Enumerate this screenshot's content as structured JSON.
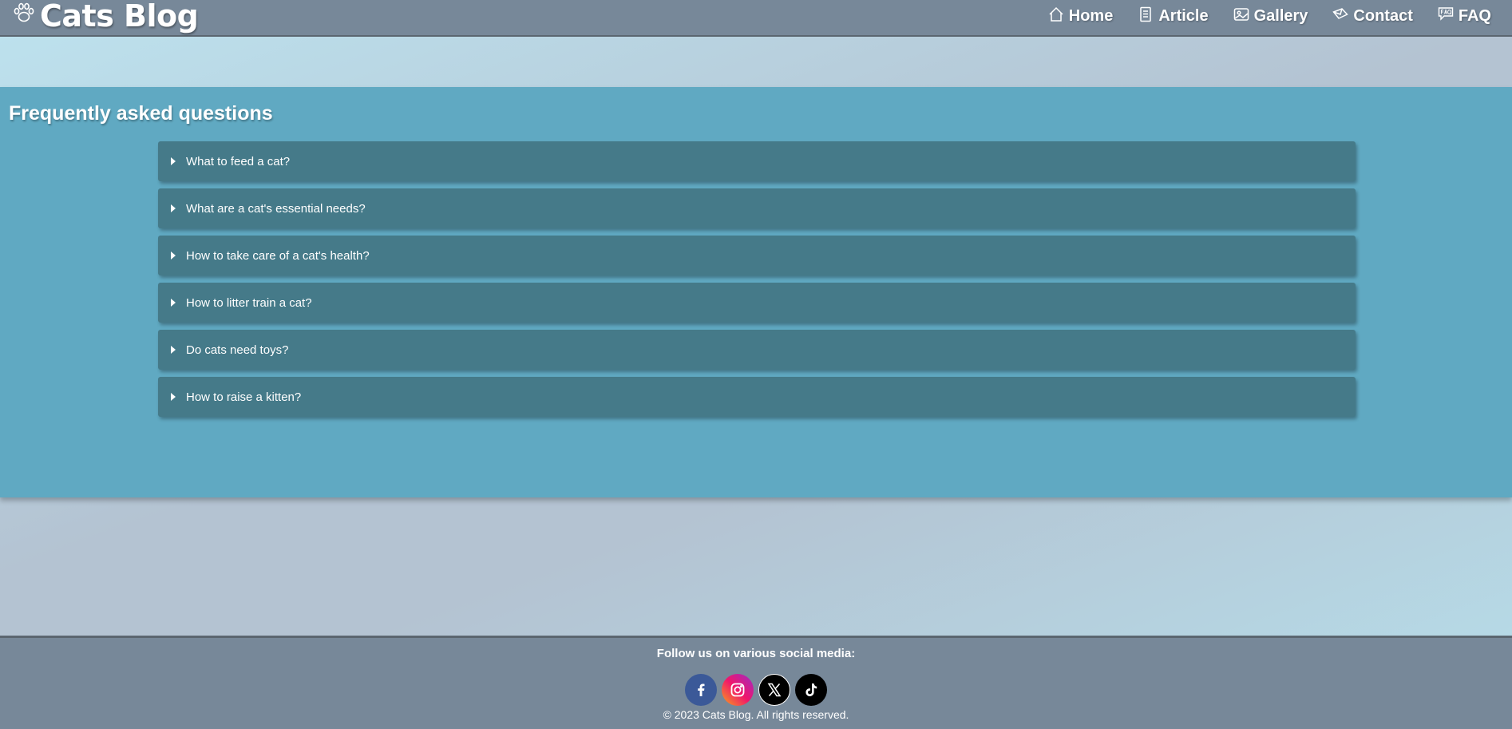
{
  "header": {
    "brand": {
      "title": "Cats Blog",
      "icon": "paw-icon"
    },
    "nav": [
      {
        "label": "Home",
        "icon": "home-icon"
      },
      {
        "label": "Article",
        "icon": "article-icon"
      },
      {
        "label": "Gallery",
        "icon": "gallery-icon"
      },
      {
        "label": "Contact",
        "icon": "contact-icon"
      },
      {
        "label": "FAQ",
        "icon": "faq-icon"
      }
    ]
  },
  "faq": {
    "title": "Frequently asked questions",
    "items": [
      "What to feed a cat?",
      "What are a cat's essential needs?",
      "How to take care of a cat's health?",
      "How to litter train a cat?",
      "Do cats need toys?",
      "How to raise a kitten?"
    ]
  },
  "footer": {
    "follow_text": "Follow us on various social media:",
    "socials": [
      {
        "icon": "facebook-icon",
        "color": "#3b5998"
      },
      {
        "icon": "instagram-icon",
        "color": "#e1306c"
      },
      {
        "icon": "x-icon",
        "color": "#000000"
      },
      {
        "icon": "tiktok-icon",
        "color": "#000000"
      }
    ],
    "copyright": "© 2023 Cats Blog. All rights reserved."
  },
  "colors": {
    "header_bg": "#778899",
    "section_bg": "#60a9c2",
    "faq_item_bg": "#457a89"
  }
}
